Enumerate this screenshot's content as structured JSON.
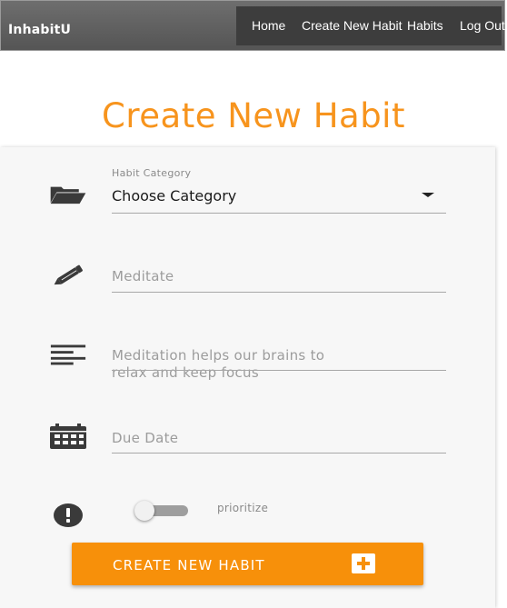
{
  "navbar": {
    "brand": "InhabitU",
    "links": [
      "Home",
      "Create New Habit",
      "Habits",
      "Log Out"
    ]
  },
  "page": {
    "title": "Create New Habit"
  },
  "form": {
    "category_label": "Habit Category",
    "category_value": "Choose Category",
    "name_placeholder": "Meditate",
    "description_placeholder_line1": "Meditation helps our brains to",
    "description_placeholder_line2": "relax and keep focus",
    "due_date_placeholder": "Due Date",
    "prioritize_label": "prioritize",
    "prioritize_on": false,
    "submit_label": "CREATE NEW HABIT"
  },
  "icons": {
    "category": "folder-open-icon",
    "name": "pencil-icon",
    "description": "notes-lines-icon",
    "due_date": "calendar-icon",
    "priority": "exclamation-circle-icon",
    "submit": "plus-box-icon"
  },
  "colors": {
    "accent": "#f7941d",
    "button": "#f7900a",
    "navbar": "#5e5e5e",
    "nav_menu": "#3d3d3d"
  }
}
